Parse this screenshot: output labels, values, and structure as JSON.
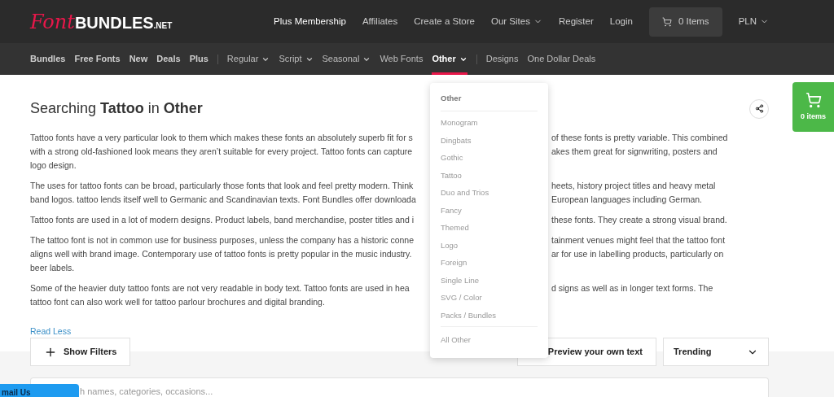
{
  "logo": {
    "script": "Font",
    "bold": "BUNDLES",
    "suffix": ".NET"
  },
  "top_nav": [
    "Plus Membership",
    "Affiliates",
    "Create a Store",
    "Our Sites",
    "Register",
    "Login"
  ],
  "cart": {
    "label": "0 Items"
  },
  "currency": "PLN",
  "category_nav": [
    {
      "label": "Bundles",
      "kind": "bold",
      "selected": false
    },
    {
      "label": "Free Fonts",
      "kind": "bold",
      "selected": false
    },
    {
      "label": "New",
      "kind": "bold",
      "selected": false
    },
    {
      "label": "Deals",
      "kind": "bold",
      "selected": false
    },
    {
      "label": "Plus",
      "kind": "bold",
      "selected": false
    },
    {
      "label": "Regular",
      "kind": "dropdown",
      "selected": false
    },
    {
      "label": "Script",
      "kind": "dropdown",
      "selected": false
    },
    {
      "label": "Seasonal",
      "kind": "dropdown",
      "selected": false
    },
    {
      "label": "Web Fonts",
      "kind": "plain",
      "selected": false
    },
    {
      "label": "Other",
      "kind": "dropdown",
      "selected": true
    },
    {
      "label": "Designs",
      "kind": "plain",
      "selected": false
    },
    {
      "label": "One Dollar Deals",
      "kind": "plain",
      "selected": false
    }
  ],
  "heading": "Searching **Tattoo** in **Other**",
  "description": [
    [
      {
        "left": "Tattoo fonts have a very particular look to them which makes these fonts an absolutely superb fit for s",
        "right": "of these fonts is pretty variable. This combined"
      },
      {
        "left": "with a strong old-fashioned look means they aren’t suitable for every project. Tattoo fonts can capture",
        "right": "akes them great for signwriting, posters and"
      },
      {
        "left": "logo design."
      }
    ],
    [
      {
        "left": "The uses for tattoo fonts can be broad, particularly those fonts that look and feel pretty modern. Think",
        "right": "heets, history project titles and heavy metal"
      },
      {
        "left": "band logos. tattoo lends itself well to Germanic and Scandinavian texts. Font Bundles offer downloada",
        "right": "European languages including German."
      }
    ],
    [
      {
        "left": "Tattoo fonts are used in a lot of modern designs. Product labels, band merchandise, poster titles and i",
        "right": "these fonts. They create a strong visual brand."
      }
    ],
    [
      {
        "left": "The tattoo font is not in common use for business purposes, unless the company has a historic conne",
        "right": "tainment venues might feel that the tattoo font"
      },
      {
        "left": "aligns well with brand image. Contemporary use of tattoo fonts is pretty popular in the music industry.",
        "right": "ar for use in labelling products, particularly on"
      },
      {
        "left": "beer labels."
      }
    ],
    [
      {
        "left": "Some of the heavier duty tattoo fonts are not very readable in body text. Tattoo fonts are used in hea",
        "right": "d signs as well as in longer text forms. The"
      },
      {
        "left": "tattoo font can also work well for tattoo parlour brochures and digital branding."
      }
    ]
  ],
  "read_less": "Read Less",
  "dropdown": {
    "title": "Other",
    "items": [
      "Monogram",
      "Dingbats",
      "Gothic",
      "Tattoo",
      "Duo and Trios",
      "Fancy",
      "Themed",
      "Logo",
      "Foreign",
      "Single Line",
      "SVG / Color",
      "Packs / Bundles"
    ],
    "footer": "All Other"
  },
  "side_cart": {
    "label": "0 items"
  },
  "show_filters": "Show Filters",
  "preview": "Preview your own text",
  "sort": {
    "value": "Trending"
  },
  "search": {
    "placeholder": "h names, categories, occasions..."
  },
  "email_us": "mail Us"
}
